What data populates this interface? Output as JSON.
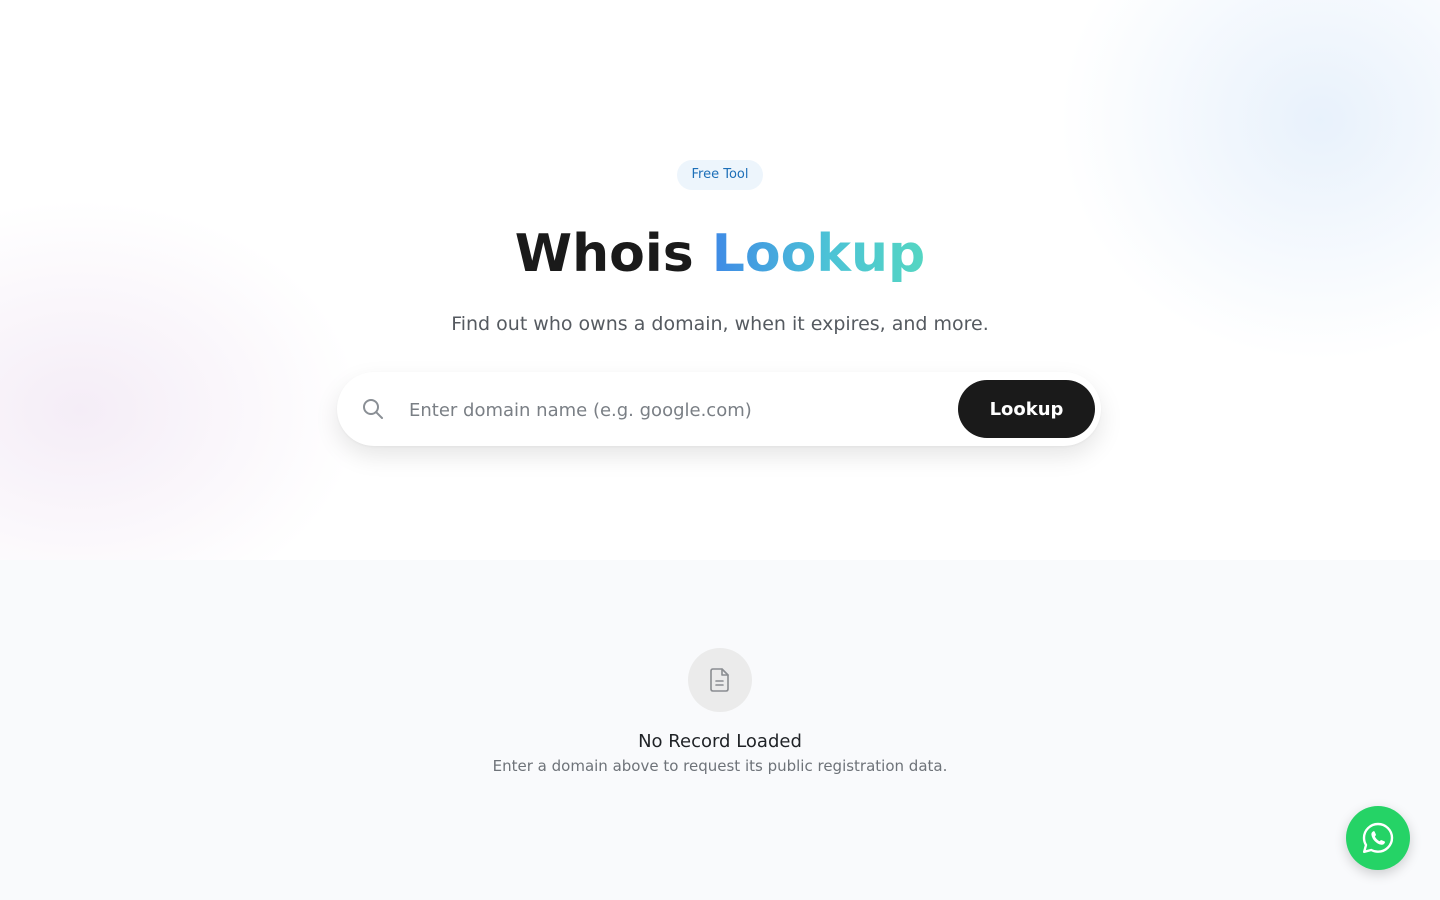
{
  "hero": {
    "badge": "Free Tool",
    "title_plain": "Whois",
    "title_accent": "Lookup",
    "subtitle": "Find out who owns a domain, when it expires, and more."
  },
  "search": {
    "placeholder": "Enter domain name (e.g. google.com)",
    "value": "",
    "button_label": "Lookup",
    "icon": "search-icon"
  },
  "empty_state": {
    "icon": "document-icon",
    "title": "No Record Loaded",
    "description": "Enter a domain above to request its public registration data."
  },
  "floating_action": {
    "icon": "whatsapp-icon"
  },
  "colors": {
    "badge_bg": "#edf5fc",
    "badge_text": "#1d6fb8",
    "accent_gradient_start": "#3f8ae6",
    "accent_gradient_end": "#55d6c2",
    "button_bg": "#1a1a1a",
    "whatsapp_green": "#25d366"
  }
}
